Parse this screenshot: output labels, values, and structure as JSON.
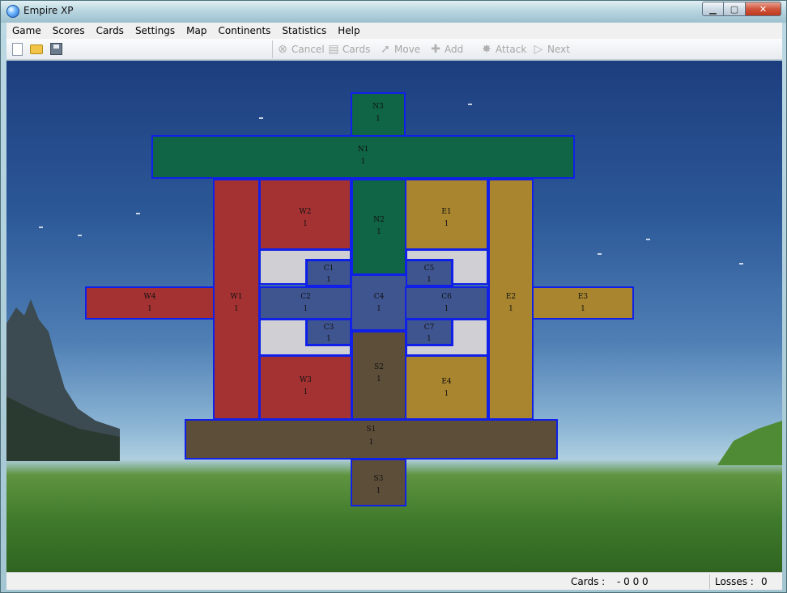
{
  "window": {
    "title": "Empire XP",
    "minimize": "▁",
    "maximize": "▢",
    "close": "✕"
  },
  "menu": [
    "Game",
    "Scores",
    "Cards",
    "Settings",
    "Map",
    "Continents",
    "Statistics",
    "Help"
  ],
  "toolbar": {
    "file_icons": [
      "new-file-icon",
      "open-folder-icon",
      "save-disk-icon"
    ],
    "actions": [
      {
        "label": "Cancel",
        "icon": "cancel-icon",
        "enabled": false
      },
      {
        "label": "Cards",
        "icon": "cards-icon",
        "enabled": false
      },
      {
        "label": "Move",
        "icon": "move-icon",
        "enabled": false
      },
      {
        "label": "Add",
        "icon": "add-icon",
        "enabled": false
      },
      {
        "label": "Attack",
        "icon": "attack-icon",
        "enabled": false
      },
      {
        "label": "Next",
        "icon": "next-icon",
        "enabled": false
      }
    ]
  },
  "colors": {
    "north": "#0f6545",
    "west": "#a53232",
    "east": "#a8852e",
    "south": "#5d4e3a",
    "center": "#3f5590",
    "neutral": "#d0d0d4",
    "border": "#1020e8"
  },
  "territories": [
    {
      "id": "N3",
      "name": "N3",
      "armies": "1",
      "owner": "north"
    },
    {
      "id": "N1",
      "name": "N1",
      "armies": "1",
      "owner": "north"
    },
    {
      "id": "W1",
      "name": "W1",
      "armies": "1",
      "owner": "west"
    },
    {
      "id": "W2",
      "name": "W2",
      "armies": "1",
      "owner": "west"
    },
    {
      "id": "N2",
      "name": "N2",
      "armies": "1",
      "owner": "north"
    },
    {
      "id": "E1",
      "name": "E1",
      "armies": "1",
      "owner": "east"
    },
    {
      "id": "E2",
      "name": "E2",
      "armies": "1",
      "owner": "east"
    },
    {
      "id": "W4",
      "name": "W4",
      "armies": "1",
      "owner": "west"
    },
    {
      "id": "E3",
      "name": "E3",
      "armies": "1",
      "owner": "east"
    },
    {
      "id": "C1",
      "name": "C1",
      "armies": "1",
      "owner": "center"
    },
    {
      "id": "C5",
      "name": "C5",
      "armies": "1",
      "owner": "center"
    },
    {
      "id": "C2",
      "name": "C2",
      "armies": "1",
      "owner": "center"
    },
    {
      "id": "C4",
      "name": "C4",
      "armies": "1",
      "owner": "center"
    },
    {
      "id": "C6",
      "name": "C6",
      "armies": "1",
      "owner": "center"
    },
    {
      "id": "C3",
      "name": "C3",
      "armies": "1",
      "owner": "center"
    },
    {
      "id": "C7",
      "name": "C7",
      "armies": "1",
      "owner": "center"
    },
    {
      "id": "W3",
      "name": "W3",
      "armies": "1",
      "owner": "west"
    },
    {
      "id": "S2",
      "name": "S2",
      "armies": "1",
      "owner": "south"
    },
    {
      "id": "E4",
      "name": "E4",
      "armies": "1",
      "owner": "east"
    },
    {
      "id": "S1",
      "name": "S1",
      "armies": "1",
      "owner": "south"
    },
    {
      "id": "S3",
      "name": "S3",
      "armies": "1",
      "owner": "south"
    }
  ],
  "status": {
    "cards_label": "Cards :",
    "cards_value": "- 0 0 0",
    "losses_label": "Losses :",
    "losses_value": "0"
  }
}
